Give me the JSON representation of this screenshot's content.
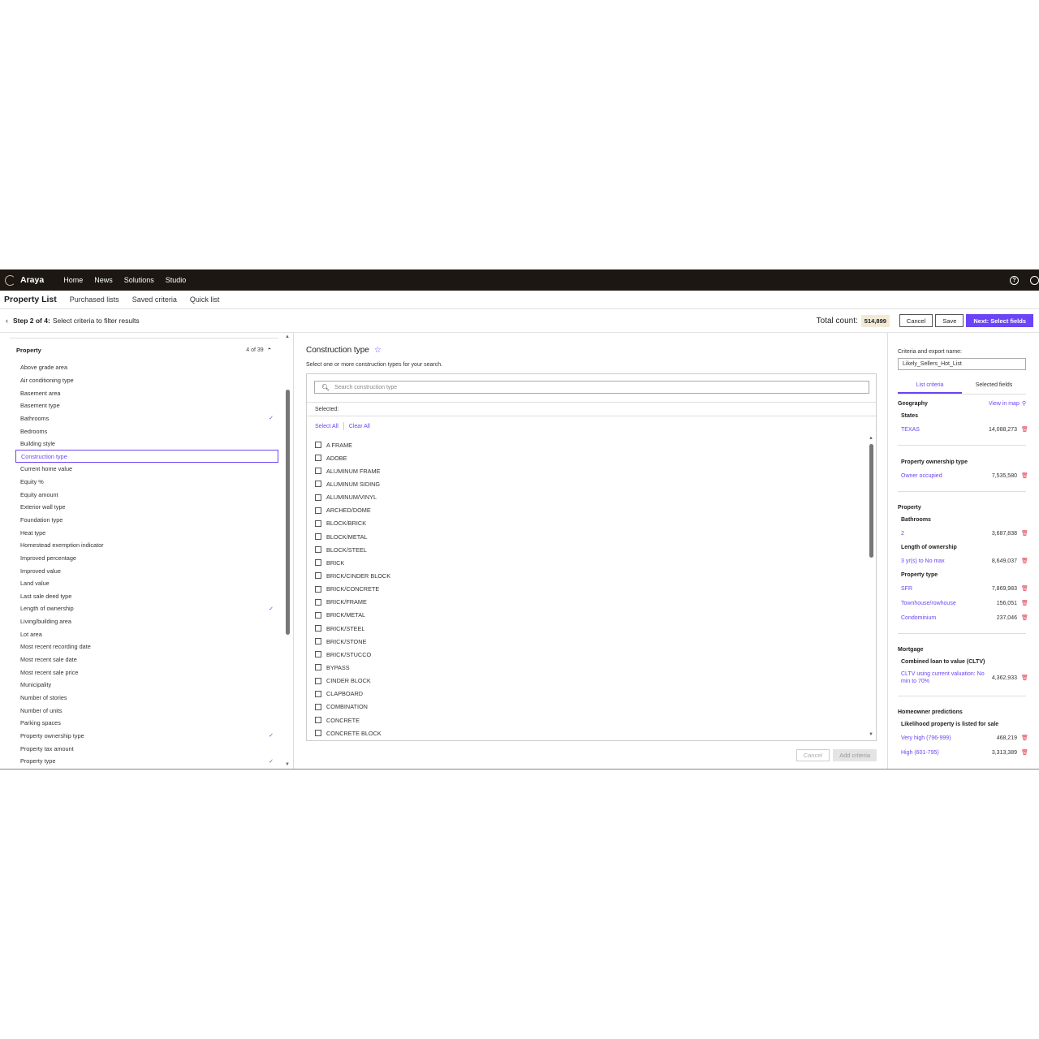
{
  "topnav": {
    "brand": "Araya",
    "links": [
      "Home",
      "News",
      "Solutions",
      "Studio"
    ]
  },
  "subnav": {
    "title": "Property List",
    "links": [
      "Purchased lists",
      "Saved criteria",
      "Quick list"
    ]
  },
  "stepbar": {
    "step": "Step 2 of 4:",
    "text": "Select criteria to filter results",
    "total_label": "Total count:",
    "total_value": "514,899",
    "cancel": "Cancel",
    "save": "Save",
    "next": "Next: Select fields"
  },
  "left": {
    "group": "Property",
    "count": "4 of 39",
    "items": [
      {
        "label": "Above grade area",
        "checked": false
      },
      {
        "label": "Air conditioning type",
        "checked": false
      },
      {
        "label": "Basement area",
        "checked": false
      },
      {
        "label": "Basement type",
        "checked": false
      },
      {
        "label": "Bathrooms",
        "checked": true
      },
      {
        "label": "Bedrooms",
        "checked": false
      },
      {
        "label": "Building style",
        "checked": false
      },
      {
        "label": "Construction type",
        "checked": false,
        "active": true
      },
      {
        "label": "Current home value",
        "checked": false
      },
      {
        "label": "Equity %",
        "checked": false
      },
      {
        "label": "Equity amount",
        "checked": false
      },
      {
        "label": "Exterior wall type",
        "checked": false
      },
      {
        "label": "Foundation type",
        "checked": false
      },
      {
        "label": "Heat type",
        "checked": false
      },
      {
        "label": "Homestead exemption indicator",
        "checked": false
      },
      {
        "label": "Improved percentage",
        "checked": false
      },
      {
        "label": "Improved value",
        "checked": false
      },
      {
        "label": "Land value",
        "checked": false
      },
      {
        "label": "Last sale deed type",
        "checked": false
      },
      {
        "label": "Length of ownership",
        "checked": true
      },
      {
        "label": "Living/building area",
        "checked": false
      },
      {
        "label": "Lot area",
        "checked": false
      },
      {
        "label": "Most recent recording date",
        "checked": false
      },
      {
        "label": "Most recent sale date",
        "checked": false
      },
      {
        "label": "Most recent sale price",
        "checked": false
      },
      {
        "label": "Municipality",
        "checked": false
      },
      {
        "label": "Number of stories",
        "checked": false
      },
      {
        "label": "Number of units",
        "checked": false
      },
      {
        "label": "Parking spaces",
        "checked": false
      },
      {
        "label": "Property ownership type",
        "checked": true
      },
      {
        "label": "Property tax amount",
        "checked": false
      },
      {
        "label": "Property type",
        "checked": true
      }
    ]
  },
  "mid": {
    "title": "Construction type",
    "description": "Select one or more construction types for your search.",
    "search_placeholder": "Search construction type",
    "selected_label": "Selected:",
    "select_all": "Select All",
    "clear_all": "Clear All",
    "options": [
      "A FRAME",
      "ADOBE",
      "ALUMINUM FRAME",
      "ALUMINUM SIDING",
      "ALUMINUM/VINYL",
      "ARCHED/DOME",
      "BLOCK/BRICK",
      "BLOCK/METAL",
      "BLOCK/STEEL",
      "BRICK",
      "BRICK/CINDER BLOCK",
      "BRICK/CONCRETE",
      "BRICK/FRAME",
      "BRICK/METAL",
      "BRICK/STEEL",
      "BRICK/STONE",
      "BRICK/STUCCO",
      "BYPASS",
      "CINDER BLOCK",
      "CLAPBOARD",
      "COMBINATION",
      "CONCRETE",
      "CONCRETE BLOCK"
    ],
    "cancel": "Cancel",
    "add": "Add criteria"
  },
  "right": {
    "name_label": "Criteria and export name:",
    "name_value": "Likely_Sellers_Hot_List",
    "tab_list": "List criteria",
    "tab_fields": "Selected fields",
    "geography": "Geography",
    "view_map": "View in map",
    "states": "States",
    "texas": "TEXAS",
    "texas_count": "14,088,273",
    "ownership_type": "Property ownership type",
    "owner_occupied": "Owner occupied",
    "owner_occupied_count": "7,535,580",
    "property": "Property",
    "bathrooms": "Bathrooms",
    "bath_val": "2",
    "bath_count": "3,687,838",
    "length": "Length of ownership",
    "length_val": "3 yr(s) to No max",
    "length_count": "8,649,037",
    "ptype": "Property type",
    "sfr": "SFR",
    "sfr_count": "7,869,983",
    "townhouse": "Townhouse/rowhouse",
    "townhouse_count": "156,051",
    "condo": "Condominium",
    "condo_count": "237,046",
    "mortgage": "Mortgage",
    "cltv": "Combined loan to value (CLTV)",
    "cltv_val": "CLTV using current valuation: No min to 70%",
    "cltv_count": "4,362,933",
    "homeowner": "Homeowner predictions",
    "likelihood": "Likelihood property is listed for sale",
    "very_high": "Very high (796-999)",
    "very_high_count": "468,219",
    "high": "High (601-795)",
    "high_count": "3,313,389"
  }
}
